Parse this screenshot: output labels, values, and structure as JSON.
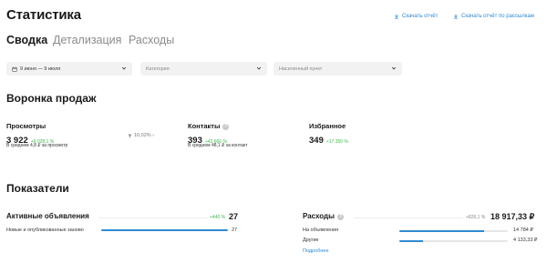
{
  "header": {
    "title": "Статистика",
    "download_report": "Скачать отчёт",
    "download_by_email": "Скачать отчёт по рассылкам"
  },
  "tabs": [
    {
      "label": "Сводка",
      "active": true
    },
    {
      "label": "Детализация",
      "active": false
    },
    {
      "label": "Расходы",
      "active": false
    }
  ],
  "filters": {
    "date_range": "9 июня — 9 июля",
    "category_placeholder": "Категория",
    "location_placeholder": "Населенный пункт"
  },
  "funnel": {
    "title": "Воронка продаж",
    "views": {
      "label": "Просмотры",
      "value": "3 922",
      "delta": "+6 028,1 %",
      "sub": "В среднем 4,8 ₽ за просмотр"
    },
    "conversion": "10,02% ›",
    "contacts": {
      "label": "Контакты",
      "value": "393",
      "delta": "+43 666 %",
      "sub": "В среднем 48,1 ₽ за контакт"
    },
    "favorites": {
      "label": "Избранное",
      "value": "349",
      "delta": "+17 350 %"
    }
  },
  "indicators": {
    "title": "Показатели",
    "active_ads": {
      "label": "Активные объявления",
      "delta": "+440 %",
      "value": "27",
      "rows": [
        {
          "label": "Новые и опубликованные заново",
          "value": "27",
          "fraction": 1.0
        }
      ]
    },
    "expenses": {
      "label": "Расходы",
      "delta": "+826,1 %",
      "value": "18 917,33 ₽",
      "rows": [
        {
          "label": "На объявления",
          "value": "14 784 ₽",
          "fraction": 0.78
        },
        {
          "label": "Другие",
          "value": "4 133,33 ₽",
          "fraction": 0.22
        }
      ],
      "more_link": "Подробнее"
    }
  },
  "colors": {
    "accent": "#2f8ad1",
    "positive": "#3fb950"
  }
}
